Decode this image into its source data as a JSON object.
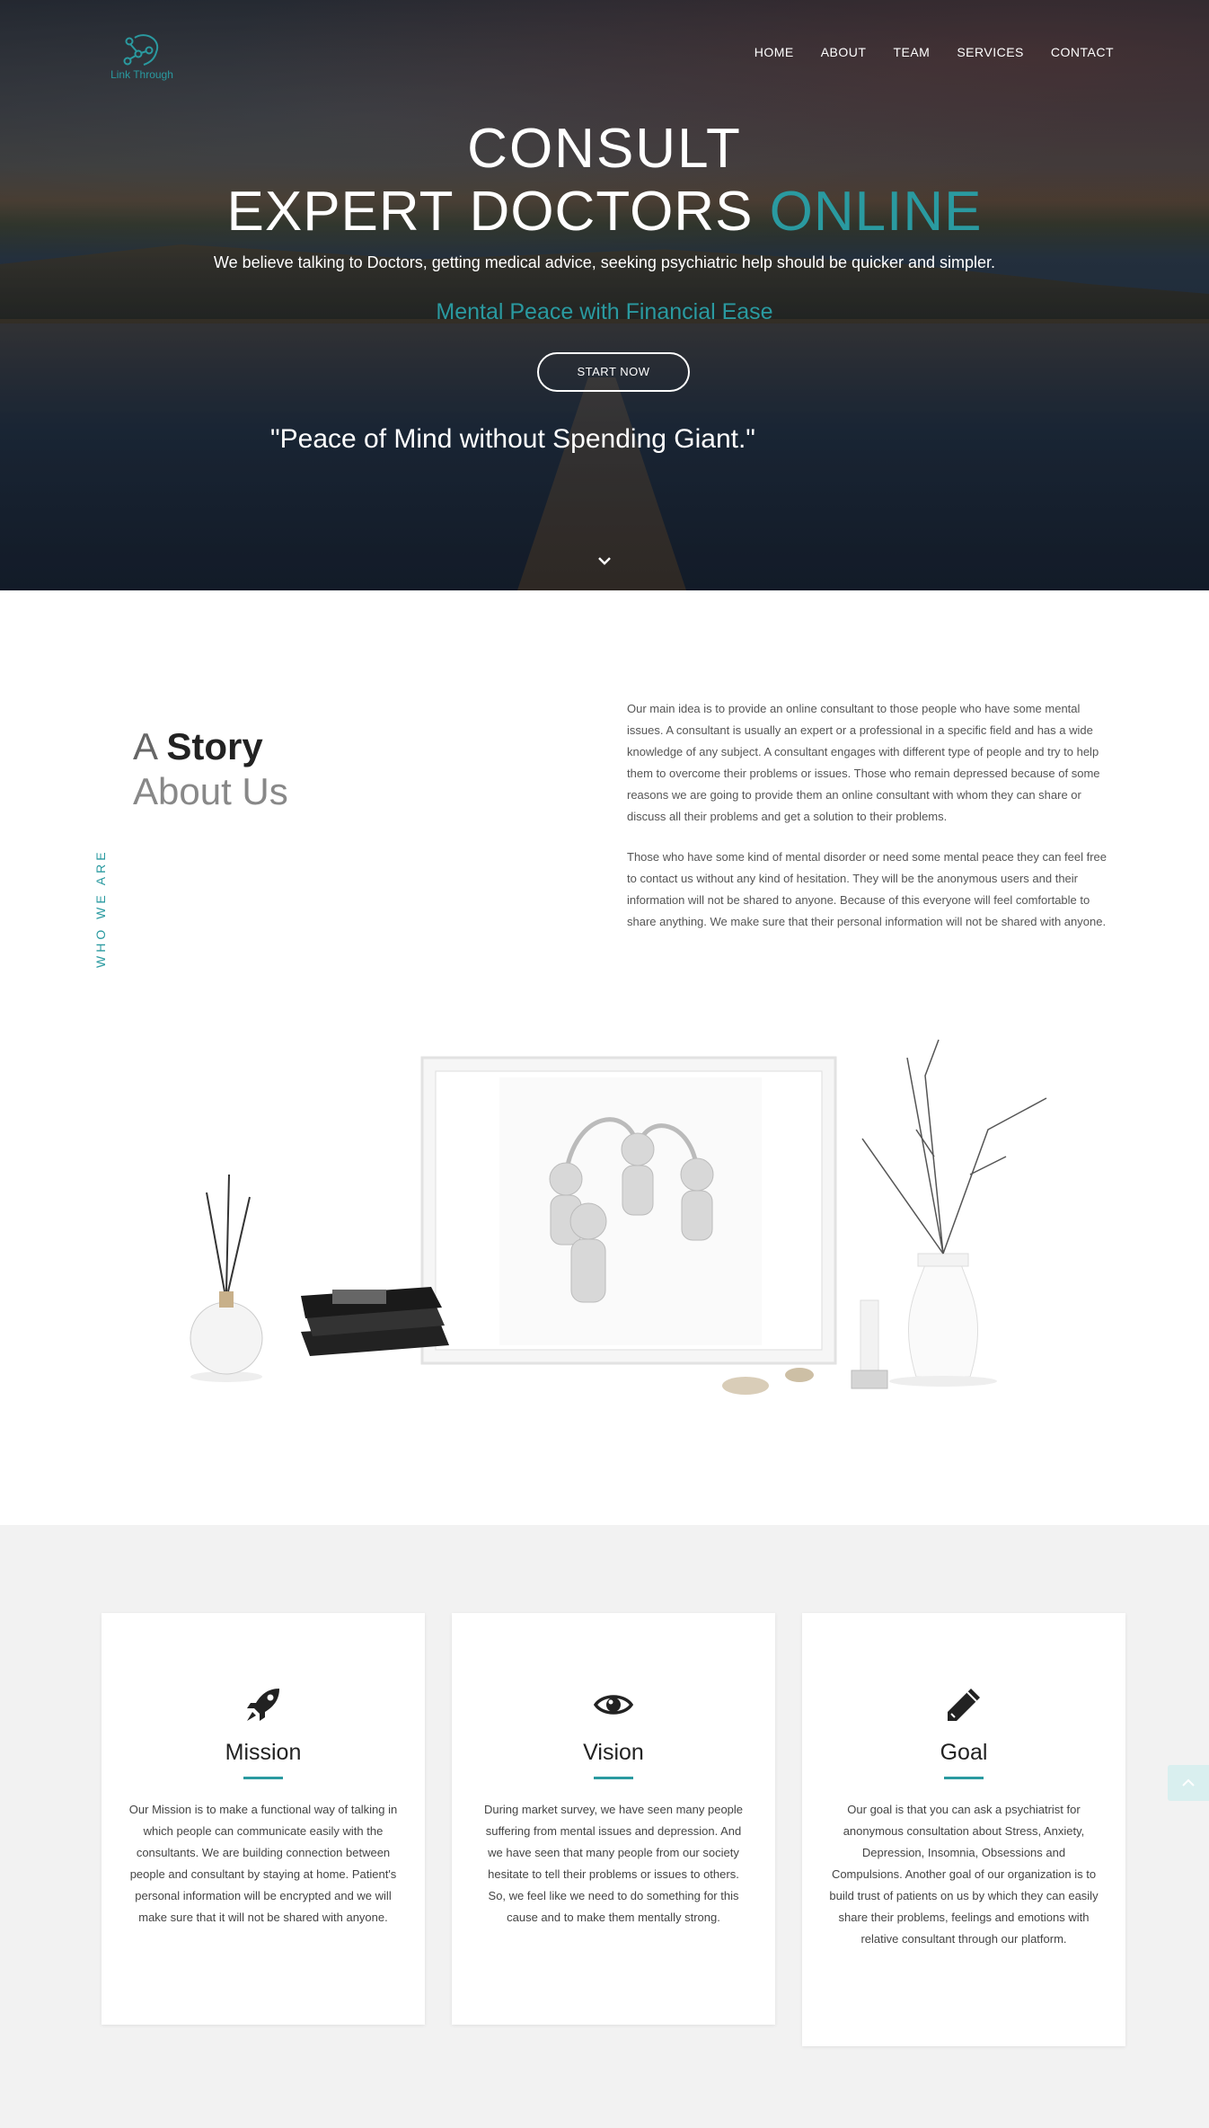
{
  "brand": {
    "logo_text": "Link Through",
    "accent": "#2a9aa0"
  },
  "nav": {
    "items": [
      "HOME",
      "ABOUT",
      "TEAM",
      "SERVICES",
      "CONTACT"
    ]
  },
  "hero": {
    "title_line1": "CONSULT",
    "title_line2_main": "EXPERT DOCTORS ",
    "title_line2_accent": "ONLINE",
    "subtitle": "We believe talking to Doctors, getting medical advice, seeking psychiatric help should be quicker and simpler.",
    "tagline": "Mental Peace with Financial Ease",
    "button": "START NOW",
    "quote": "\"Peace of Mind without Spending Giant.\"",
    "scroll_icon": "chevron-down-icon"
  },
  "story": {
    "vertical_label": "WHO WE ARE",
    "title_prefix": "A ",
    "title_bold": "Story",
    "title_line2": "About Us",
    "paragraphs": [
      "Our main idea is to provide an online consultant to those people who have some mental issues. A consultant is usually an expert or a professional in a specific field and has a wide knowledge of any subject. A consultant engages with different type of people and try to help them to overcome their problems or issues. Those who remain depressed because of some reasons we are going to provide them an online consultant with whom they can share or discuss all their problems and get a solution to their problems.",
      "Those who have some kind of mental disorder or need some mental peace they can feel free to contact us without any kind of hesitation. They will be the anonymous users and their information will not be shared to anyone. Because of this everyone will feel comfortable to share anything. We make sure that their personal information will not be shared with anyone."
    ]
  },
  "features": [
    {
      "icon": "rocket-icon",
      "title": "Mission",
      "text": "Our Mission is to make a functional way of talking in which people can communicate easily with the consultants. We are building connection between people and consultant by staying at home. Patient's personal information will be encrypted and we will make sure that it will not be shared with anyone."
    },
    {
      "icon": "eye-icon",
      "title": "Vision",
      "text": "During market survey, we have seen many people suffering from mental issues and depression. And we have seen that many people from our society hesitate to tell their problems or issues to others. So, we feel like we need to do something for this cause and to make them mentally strong."
    },
    {
      "icon": "pencil-icon",
      "title": "Goal",
      "text": "Our goal is that you can ask a psychiatrist for anonymous consultation about Stress, Anxiety, Depression, Insomnia, Obsessions and Compulsions. Another goal of our organization is to build trust of patients on us by which they can easily share their problems, feelings and emotions with relative consultant through our platform."
    }
  ]
}
